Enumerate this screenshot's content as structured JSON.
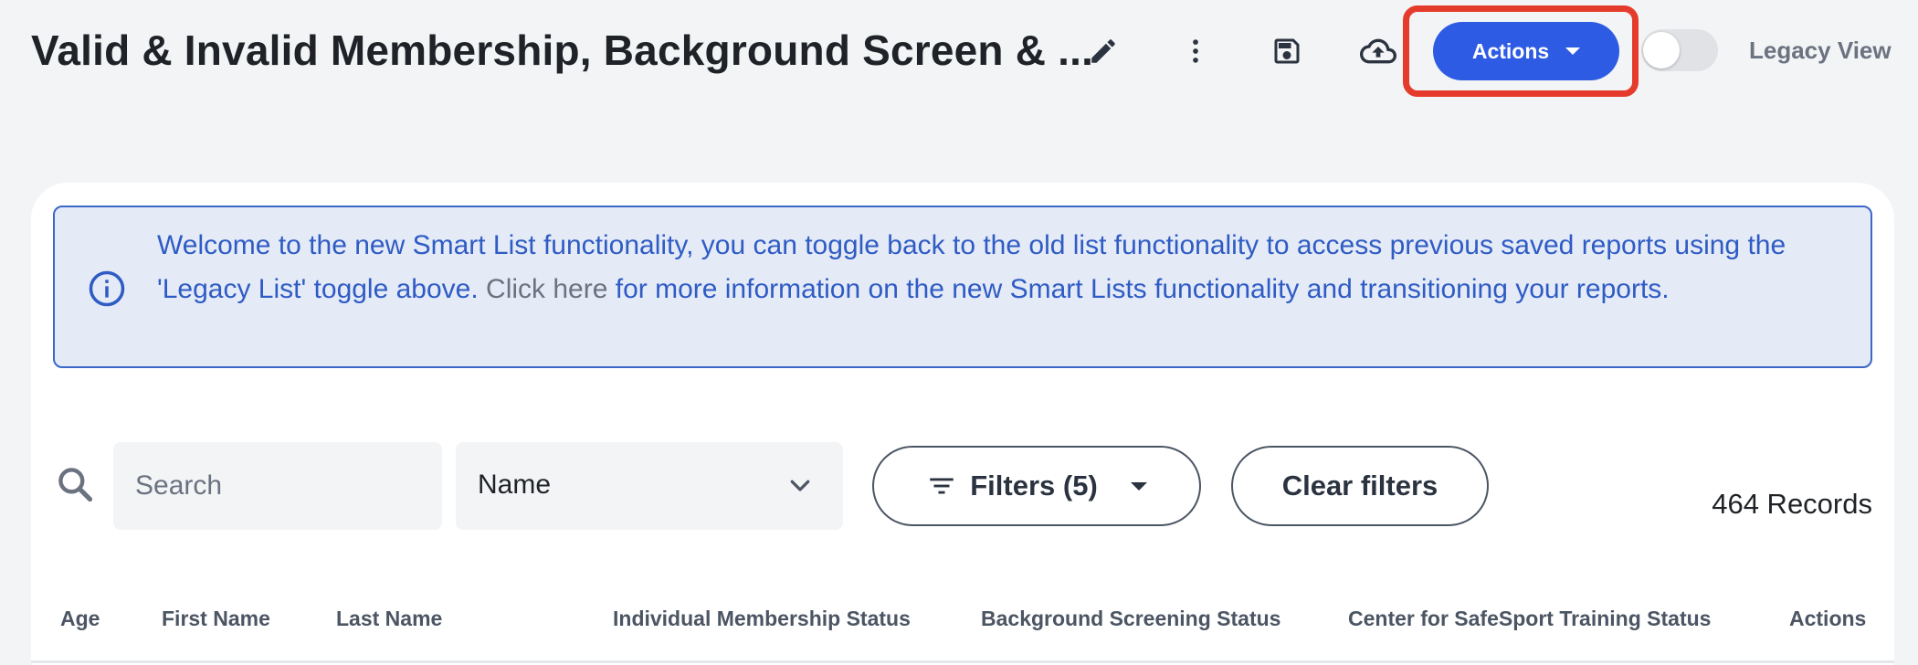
{
  "header": {
    "title": "Valid & Invalid Membership, Background Screen & ...",
    "actions_label": "Actions",
    "legacy_view_label": "Legacy View",
    "legacy_view_enabled": false
  },
  "banner": {
    "text_part1": "Welcome to the new Smart List functionality, you can toggle back to the old list functionality to access previous saved reports using the 'Legacy List' toggle above. ",
    "text_part2": "Click here",
    "text_part3": " for more information on the new Smart Lists functionality and transitioning your reports."
  },
  "toolbar": {
    "search_placeholder": "Search",
    "search_value": "",
    "field_selected": "Name",
    "filters_label": "Filters (5)",
    "clear_label": "Clear filters",
    "records": "464 Records"
  },
  "table": {
    "columns": [
      "Age",
      "First Name",
      "Last Name",
      "Individual Membership Status",
      "Background Screening Status",
      "Center for SafeSport Training Status",
      "Actions"
    ]
  },
  "colors": {
    "accent": "#2d5be3",
    "highlight": "#e53b2c",
    "banner_bg": "#e4ebf7",
    "banner_text": "#2f5bc4"
  }
}
